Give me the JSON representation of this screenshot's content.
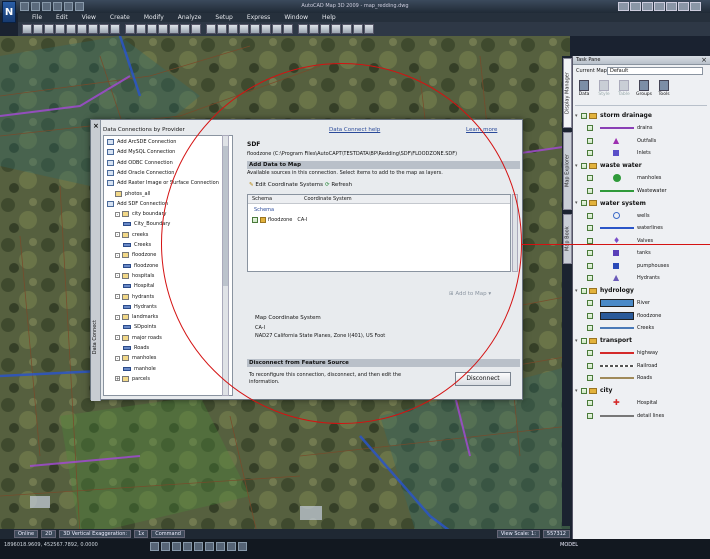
{
  "window": {
    "title": "AutoCAD Map 3D 2009 - map_redding.dwg",
    "menu": [
      "File",
      "Edit",
      "View",
      "Create",
      "Modify",
      "Analyze",
      "Setup",
      "Express",
      "Window",
      "Help"
    ]
  },
  "statusbar": {
    "online": "Online",
    "mode2d": "2D",
    "mode3d": "3D Vertical Exaggeration:",
    "exaggeration": "1x",
    "command": "Command",
    "viewscale_label": "View Scale: 1:",
    "viewscale": "557312",
    "coords": "1896018.9609, 452567.7892, 0.0000",
    "model": "MODEL"
  },
  "side_tabs": [
    "Display Manager",
    "Map Explorer",
    "Map Book"
  ],
  "taskpane": {
    "title": "Task Pane",
    "current_map_label": "Current Map:",
    "current_map": "Default",
    "tools": [
      "Data",
      "Style",
      "Table",
      "Groups",
      "Tools"
    ],
    "groups": [
      {
        "name": "storm drainage",
        "layers": [
          {
            "name": "drains",
            "symbol": "line",
            "color": "#8a3fb5"
          },
          {
            "name": "Outfalls",
            "symbol": "triangle",
            "color": "#9c2fb0"
          },
          {
            "name": "Inlets",
            "symbol": "square",
            "color": "#5a4fc8"
          }
        ]
      },
      {
        "name": "waste water",
        "layers": [
          {
            "name": "manholes",
            "symbol": "dot",
            "color": "#2f9a3a"
          },
          {
            "name": "Wastewater",
            "symbol": "line",
            "color": "#2f9a3a"
          }
        ]
      },
      {
        "name": "water system",
        "layers": [
          {
            "name": "wells",
            "symbol": "circle",
            "color": "#3c6ac8"
          },
          {
            "name": "waterlines",
            "symbol": "line",
            "color": "#2a55c8"
          },
          {
            "name": "Valves",
            "symbol": "diamond",
            "color": "#7a4fc8"
          },
          {
            "name": "tanks",
            "symbol": "square",
            "color": "#5a3fb8"
          },
          {
            "name": "pumphouses",
            "symbol": "square",
            "color": "#2a4ab8"
          },
          {
            "name": "Hydrants",
            "symbol": "triangle",
            "color": "#6a5ab8"
          }
        ]
      },
      {
        "name": "hydrology",
        "layers": [
          {
            "name": "River",
            "symbol": "box",
            "color": "#4a8ac8"
          },
          {
            "name": "floodzone",
            "symbol": "box",
            "color": "#2a5a9a"
          },
          {
            "name": "Creeks",
            "symbol": "line",
            "color": "#4a7ab8"
          }
        ]
      },
      {
        "name": "transport",
        "layers": [
          {
            "name": "highway",
            "symbol": "line",
            "color": "#d42a2a"
          },
          {
            "name": "Railroad",
            "symbol": "rail",
            "color": "#555555"
          },
          {
            "name": "Roads",
            "symbol": "line",
            "color": "#a08a5a"
          }
        ]
      },
      {
        "name": "city",
        "layers": [
          {
            "name": "Hospital",
            "symbol": "cross",
            "color": "#d42a2a"
          },
          {
            "name": "detail lines",
            "symbol": "line",
            "color": "#777777"
          }
        ]
      }
    ]
  },
  "dialog": {
    "providers_label": "Data Connections by Provider",
    "tree": [
      {
        "label": "Add ArcSDE Connection",
        "level": 0,
        "kind": "db"
      },
      {
        "label": "Add MySQL Connection",
        "level": 0,
        "kind": "db"
      },
      {
        "label": "Add ODBC Connection",
        "level": 0,
        "kind": "db"
      },
      {
        "label": "Add Oracle Connection",
        "level": 0,
        "kind": "db"
      },
      {
        "label": "Add Raster Image or Surface Connection",
        "level": 0,
        "kind": "db"
      },
      {
        "label": "photos_all",
        "level": 1,
        "kind": "folder"
      },
      {
        "label": "Add SDF Connection",
        "level": 0,
        "kind": "db"
      },
      {
        "label": "city boundary",
        "level": 1,
        "kind": "folder",
        "pm": "-"
      },
      {
        "label": "City_Boundary",
        "level": 2,
        "kind": "feat"
      },
      {
        "label": "creeks",
        "level": 1,
        "kind": "folder",
        "pm": "-"
      },
      {
        "label": "Creeks",
        "level": 2,
        "kind": "feat"
      },
      {
        "label": "floodzone",
        "level": 1,
        "kind": "folder",
        "pm": "-"
      },
      {
        "label": "floodzone",
        "level": 2,
        "kind": "feat"
      },
      {
        "label": "hospitals",
        "level": 1,
        "kind": "folder",
        "pm": "-"
      },
      {
        "label": "Hospital",
        "level": 2,
        "kind": "feat"
      },
      {
        "label": "hydrants",
        "level": 1,
        "kind": "folder",
        "pm": "-"
      },
      {
        "label": "Hydrants",
        "level": 2,
        "kind": "feat"
      },
      {
        "label": "landmarks",
        "level": 1,
        "kind": "folder",
        "pm": "-"
      },
      {
        "label": "SDpoints",
        "level": 2,
        "kind": "feat"
      },
      {
        "label": "major roads",
        "level": 1,
        "kind": "folder",
        "pm": "-"
      },
      {
        "label": "Roads",
        "level": 2,
        "kind": "feat"
      },
      {
        "label": "manholes",
        "level": 1,
        "kind": "folder",
        "pm": "-"
      },
      {
        "label": "manhole",
        "level": 2,
        "kind": "feat"
      },
      {
        "label": "parcels",
        "level": 1,
        "kind": "folder",
        "pm": "+"
      }
    ],
    "help_link": "Data Connect help",
    "learn_link": "Learn more",
    "sdf_title": "SDF",
    "sdf_path": "floodzone (C:\\Program Files\\AutoCAPT\\TESTDATA\\BP\\Redding\\SDF\\FLOODZONE.SDF)",
    "add_section": "Add Data to Map",
    "available_text": "Available sources in this connection.  Select items to add to the map as layers.",
    "edit_cs": "Edit Coordinate Systems",
    "refresh": "Refresh",
    "col_schema": "Schema",
    "col_cs": "Coordinate System",
    "schema_name": "Schema",
    "row_name": "floodzone",
    "row_cs": "CA-I",
    "add_to_map": "Add to Map",
    "map_cs_label": "Map Coordinate System",
    "map_cs_code": "CA-I",
    "map_cs_desc": "NAD27 California State Planes, Zone I(401), US Foot",
    "disconnect_section": "Disconnect from Feature Source",
    "disconnect_text": "To reconfigure this connection, disconnect, and then edit the information.",
    "disconnect_btn": "Disconnect",
    "side_label": "Data Connect"
  },
  "annotation_color": "#d41212"
}
